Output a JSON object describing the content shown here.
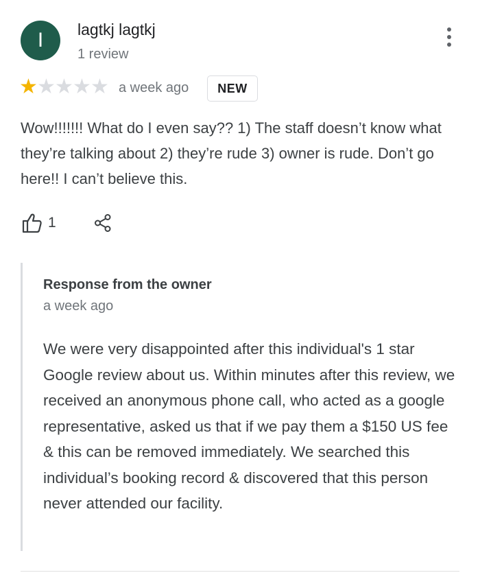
{
  "reviewer": {
    "initial": "I",
    "name": "lagtkj lagtkj",
    "review_count": "1 review",
    "avatar_color": "#1f5c4b"
  },
  "rating": {
    "stars": 1,
    "max_stars": 5,
    "time": "a week ago",
    "badge": "NEW",
    "star_color": "#f4b400"
  },
  "review": {
    "text": "Wow!!!!!!!  What do I even say?? 1) The staff doesn’t know what they’re talking about 2) they’re rude 3) owner is rude. Don’t go here!! I can’t believe this."
  },
  "actions": {
    "like_count": "1",
    "like_icon": "thumbs-up-icon",
    "share_icon": "share-icon",
    "menu_icon": "more-vert-icon"
  },
  "owner_response": {
    "title": "Response from the owner",
    "time": "a week ago",
    "text": "We were very disappointed after this individual's 1 star Google review about us. Within minutes after this review, we received an anonymous phone call, who acted as a google representative, asked us that if we pay them a $150 US fee & this can be removed immediately. We searched this individual’s booking record & discovered that this person never attended our facility."
  }
}
